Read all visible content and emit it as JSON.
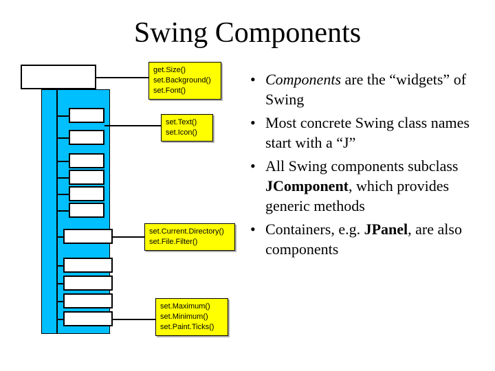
{
  "title": "Swing Components",
  "callouts": {
    "c1": {
      "l1": "get.Size()",
      "l2": "set.Background()",
      "l3": "set.Font()"
    },
    "c2": {
      "l1": "set.Text()",
      "l2": "set.Icon()"
    },
    "c3": {
      "l1": "set.Current.Directory()",
      "l2": "set.File.Filter()"
    },
    "c4": {
      "l1": "set.Maximum()",
      "l2": "set.Minimum()",
      "l3": "set.Paint.Ticks()"
    }
  },
  "bullets": {
    "b1a": "Components",
    "b1b": " are the “widgets” of Swing",
    "b2": "Most concrete Swing class names start with a “J”",
    "b3a": "All Swing components subclass ",
    "b3b": "JComponent",
    "b3c": ", which provides generic methods",
    "b4a": "Containers, e.g. ",
    "b4b": "JPanel",
    "b4c": ", are also components"
  }
}
